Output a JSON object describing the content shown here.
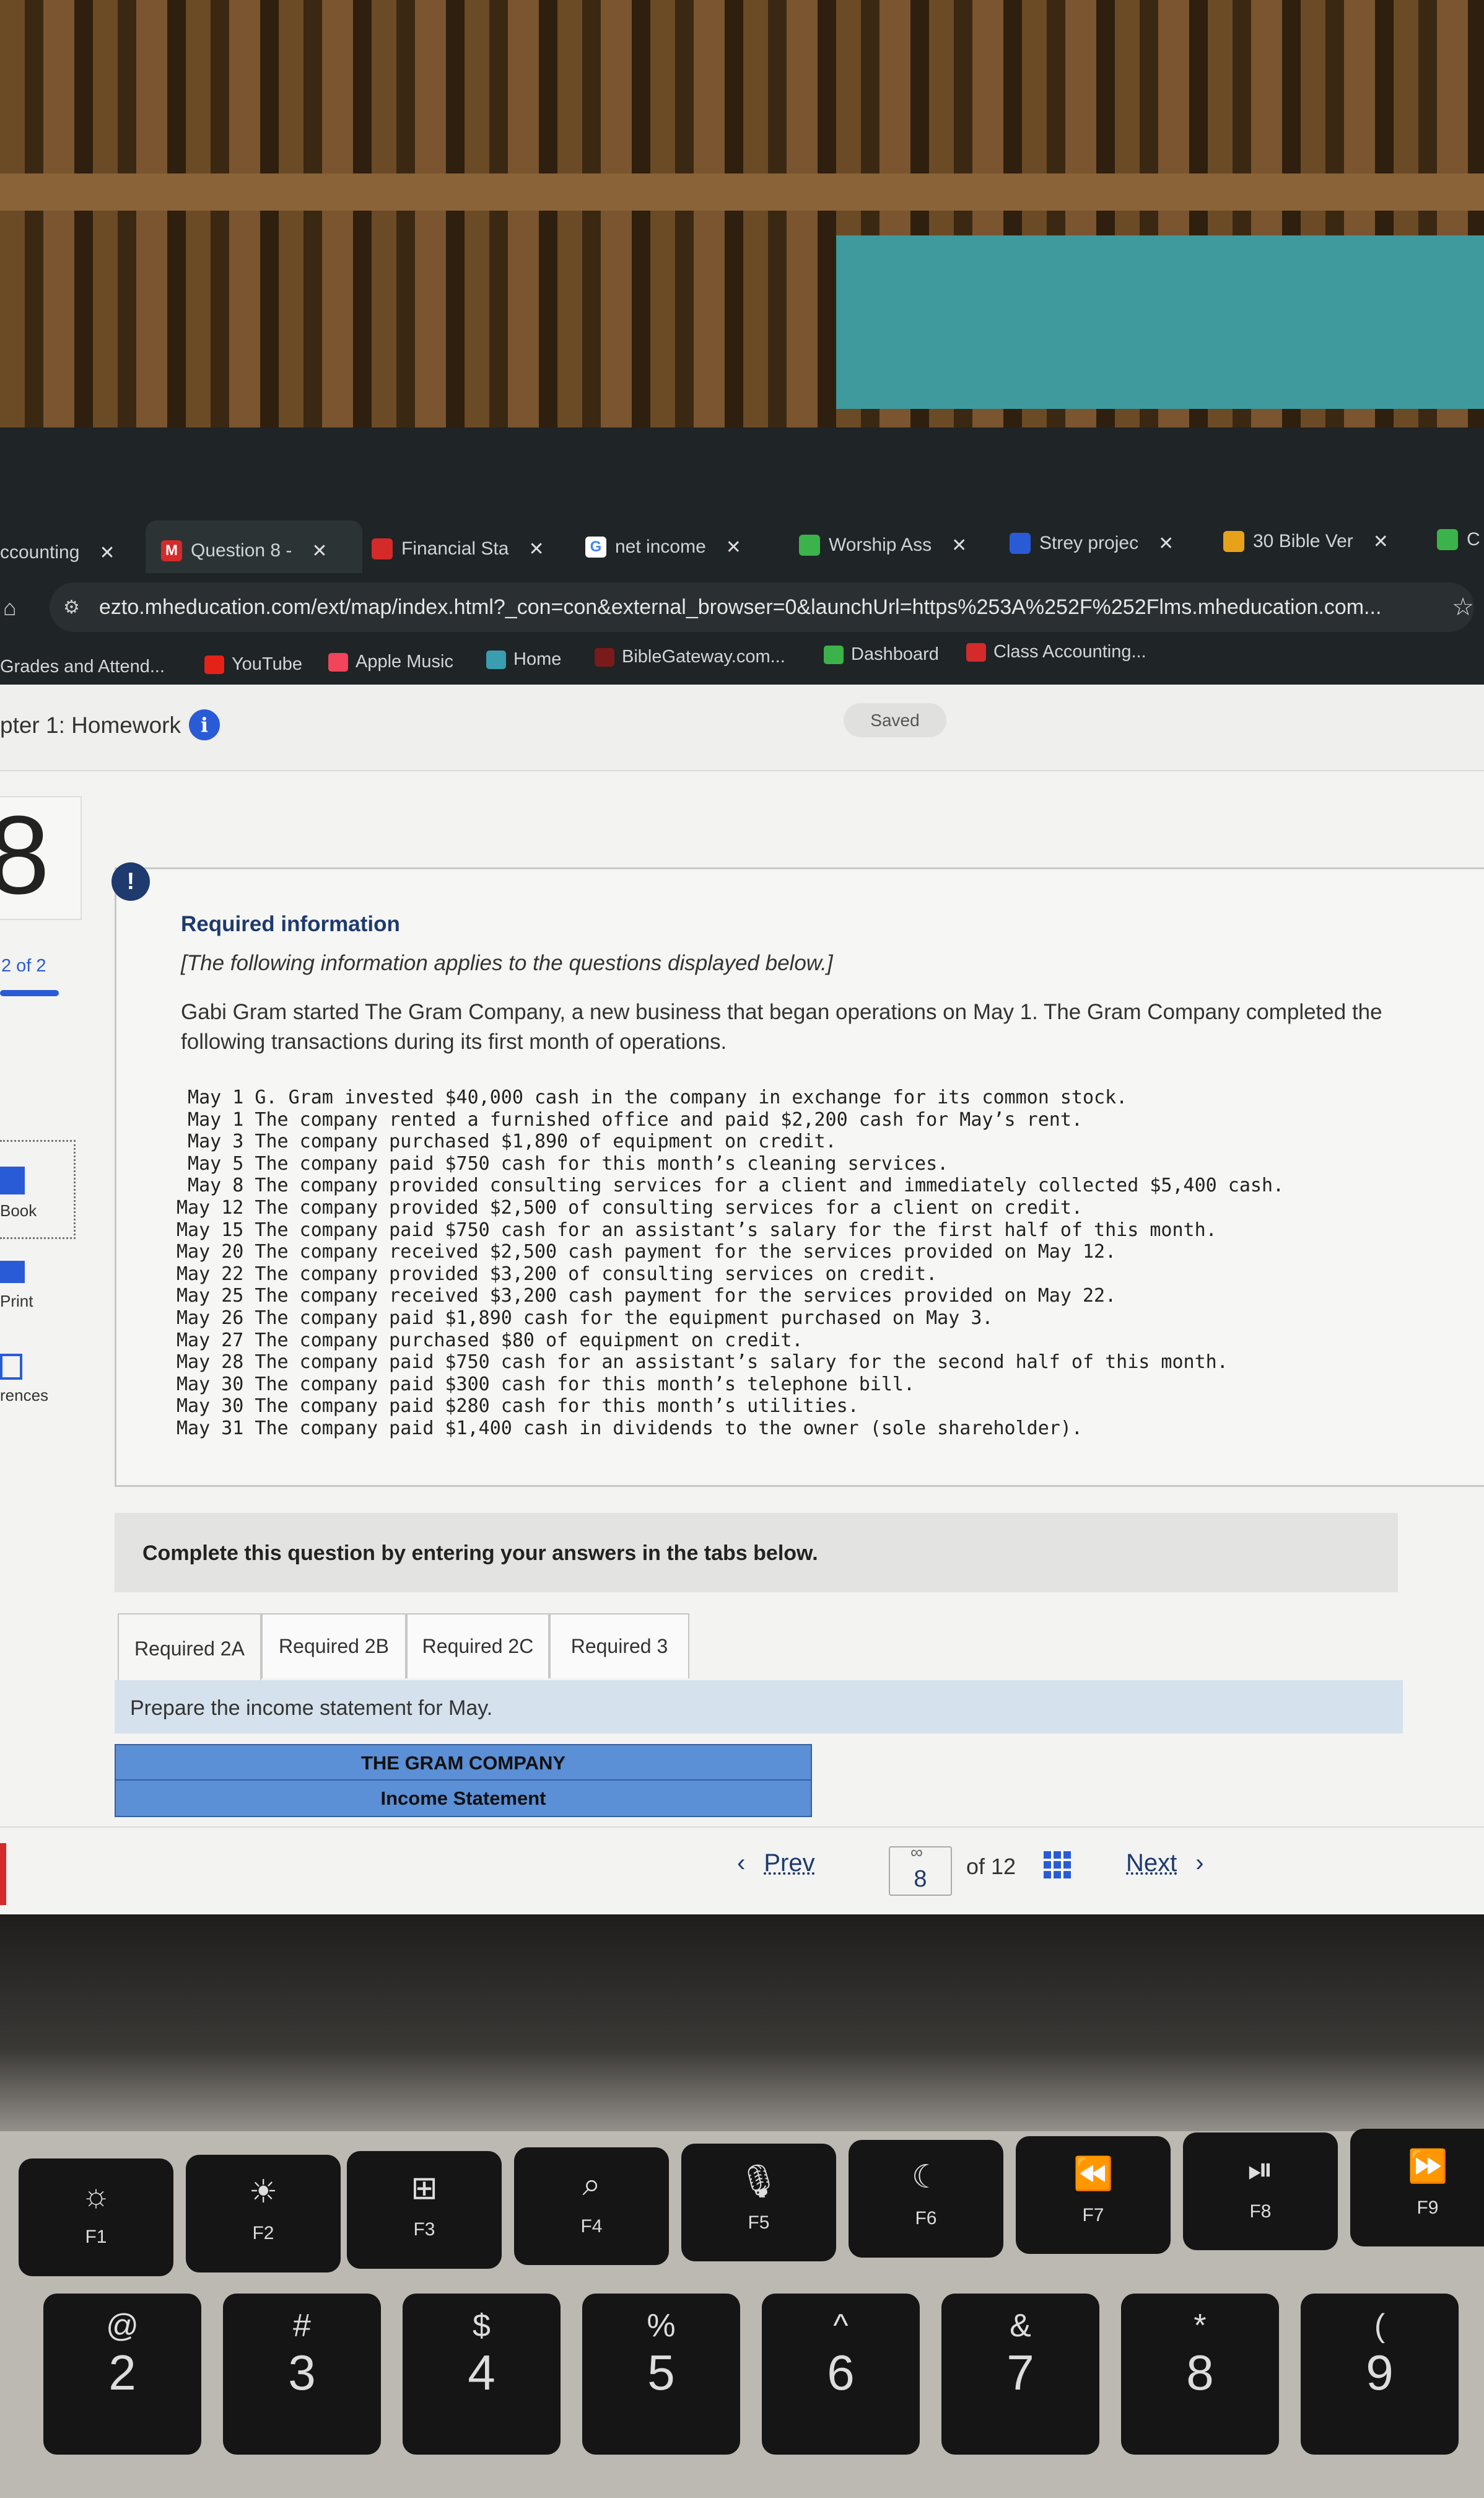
{
  "browser": {
    "tabs": [
      {
        "label": "ccounting",
        "icon": "generic"
      },
      {
        "label": "Question 8 -",
        "icon": "mheducation-m",
        "active": true
      },
      {
        "label": "Financial Sta",
        "icon": "slides"
      },
      {
        "label": "net income",
        "icon": "google"
      },
      {
        "label": "Worship Ass",
        "icon": "classroom"
      },
      {
        "label": "Strey projec",
        "icon": "docs"
      },
      {
        "label": "30 Bible Ver",
        "icon": "star-bookmark"
      },
      {
        "label": "C",
        "icon": "classroom"
      }
    ],
    "url": "ezto.mheducation.com/ext/map/index.html?_con=con&external_browser=0&launchUrl=https%253A%252F%252Flms.mheducation.com...",
    "bookmarks": [
      {
        "label": "Grades and Attend...",
        "color": "#2a5bd7"
      },
      {
        "label": "YouTube",
        "color": "#e62117"
      },
      {
        "label": "Apple Music",
        "color": "#f2445b"
      },
      {
        "label": "Home",
        "color": "#3a9db0"
      },
      {
        "label": "BibleGateway.com...",
        "color": "#7a1a1a"
      },
      {
        "label": "Dashboard",
        "color": "#3bb34a"
      },
      {
        "label": "Class Accounting...",
        "color": "#d42a2a"
      }
    ]
  },
  "header": {
    "title": "pter 1: Homework",
    "saved": "Saved"
  },
  "sidebar": {
    "question_number": "8",
    "progress": "2 of 2",
    "progress_fraction": 1.0,
    "items": [
      {
        "label": "Book"
      },
      {
        "label": "Print"
      },
      {
        "label": "rences"
      }
    ]
  },
  "info": {
    "heading": "Required information",
    "note": "[The following information applies to the questions displayed below.]",
    "intro": "Gabi Gram started The Gram Company, a new business that began operations on May 1. The Gram Company completed the following transactions during its first month of operations.",
    "transactions": [
      {
        "date": "May 1",
        "text": "G. Gram invested $40,000 cash in the company in exchange for its common stock."
      },
      {
        "date": "May 1",
        "text": "The company rented a furnished office and paid $2,200 cash for May’s rent."
      },
      {
        "date": "May 3",
        "text": "The company purchased $1,890 of equipment on credit."
      },
      {
        "date": "May 5",
        "text": "The company paid $750 cash for this month’s cleaning services."
      },
      {
        "date": "May 8",
        "text": "The company provided consulting services for a client and immediately collected $5,400 cash."
      },
      {
        "date": "May 12",
        "text": "The company provided $2,500 of consulting services for a client on credit."
      },
      {
        "date": "May 15",
        "text": "The company paid $750 cash for an assistant’s salary for the first half of this month."
      },
      {
        "date": "May 20",
        "text": "The company received $2,500 cash payment for the services provided on May 12."
      },
      {
        "date": "May 22",
        "text": "The company provided $3,200 of consulting services on credit."
      },
      {
        "date": "May 25",
        "text": "The company received $3,200 cash payment for the services provided on May 22."
      },
      {
        "date": "May 26",
        "text": "The company paid $1,890 cash for the equipment purchased on May 3."
      },
      {
        "date": "May 27",
        "text": "The company purchased $80 of equipment on credit."
      },
      {
        "date": "May 28",
        "text": "The company paid $750 cash for an assistant’s salary for the second half of this month."
      },
      {
        "date": "May 30",
        "text": "The company paid $300 cash for this month’s telephone bill."
      },
      {
        "date": "May 30",
        "text": "The company paid $280 cash for this month’s utilities."
      },
      {
        "date": "May 31",
        "text": "The company paid $1,400 cash in dividends to the owner (sole shareholder)."
      }
    ]
  },
  "question": {
    "instruction": "Complete this question by entering your answers in the tabs below.",
    "tabs": [
      "Required 2A",
      "Required 2B",
      "Required 2C",
      "Required 3"
    ],
    "active_tab": "Required 2A",
    "prompt": "Prepare the income statement for May.",
    "company": "THE GRAM COMPANY",
    "statement": "Income Statement"
  },
  "nav": {
    "prev": "Prev",
    "current": "8",
    "of": "of 12",
    "next": "Next"
  },
  "keyboard": {
    "fkeys": [
      {
        "label": "F1",
        "icon": "☼"
      },
      {
        "label": "F2",
        "icon": "☀"
      },
      {
        "label": "F3",
        "icon": "⊞"
      },
      {
        "label": "F4",
        "icon": "⌕"
      },
      {
        "label": "F5",
        "icon": "🎙"
      },
      {
        "label": "F6",
        "icon": "☾"
      },
      {
        "label": "F7",
        "icon": "⏪"
      },
      {
        "label": "F8",
        "icon": "⏯"
      },
      {
        "label": "F9",
        "icon": "⏩"
      }
    ],
    "numkeys": [
      {
        "sym": "@",
        "digit": "2"
      },
      {
        "sym": "#",
        "digit": "3"
      },
      {
        "sym": "$",
        "digit": "4"
      },
      {
        "sym": "%",
        "digit": "5"
      },
      {
        "sym": "^",
        "digit": "6"
      },
      {
        "sym": "&",
        "digit": "7"
      },
      {
        "sym": "*",
        "digit": "8"
      },
      {
        "sym": "(",
        "digit": "9"
      }
    ]
  }
}
